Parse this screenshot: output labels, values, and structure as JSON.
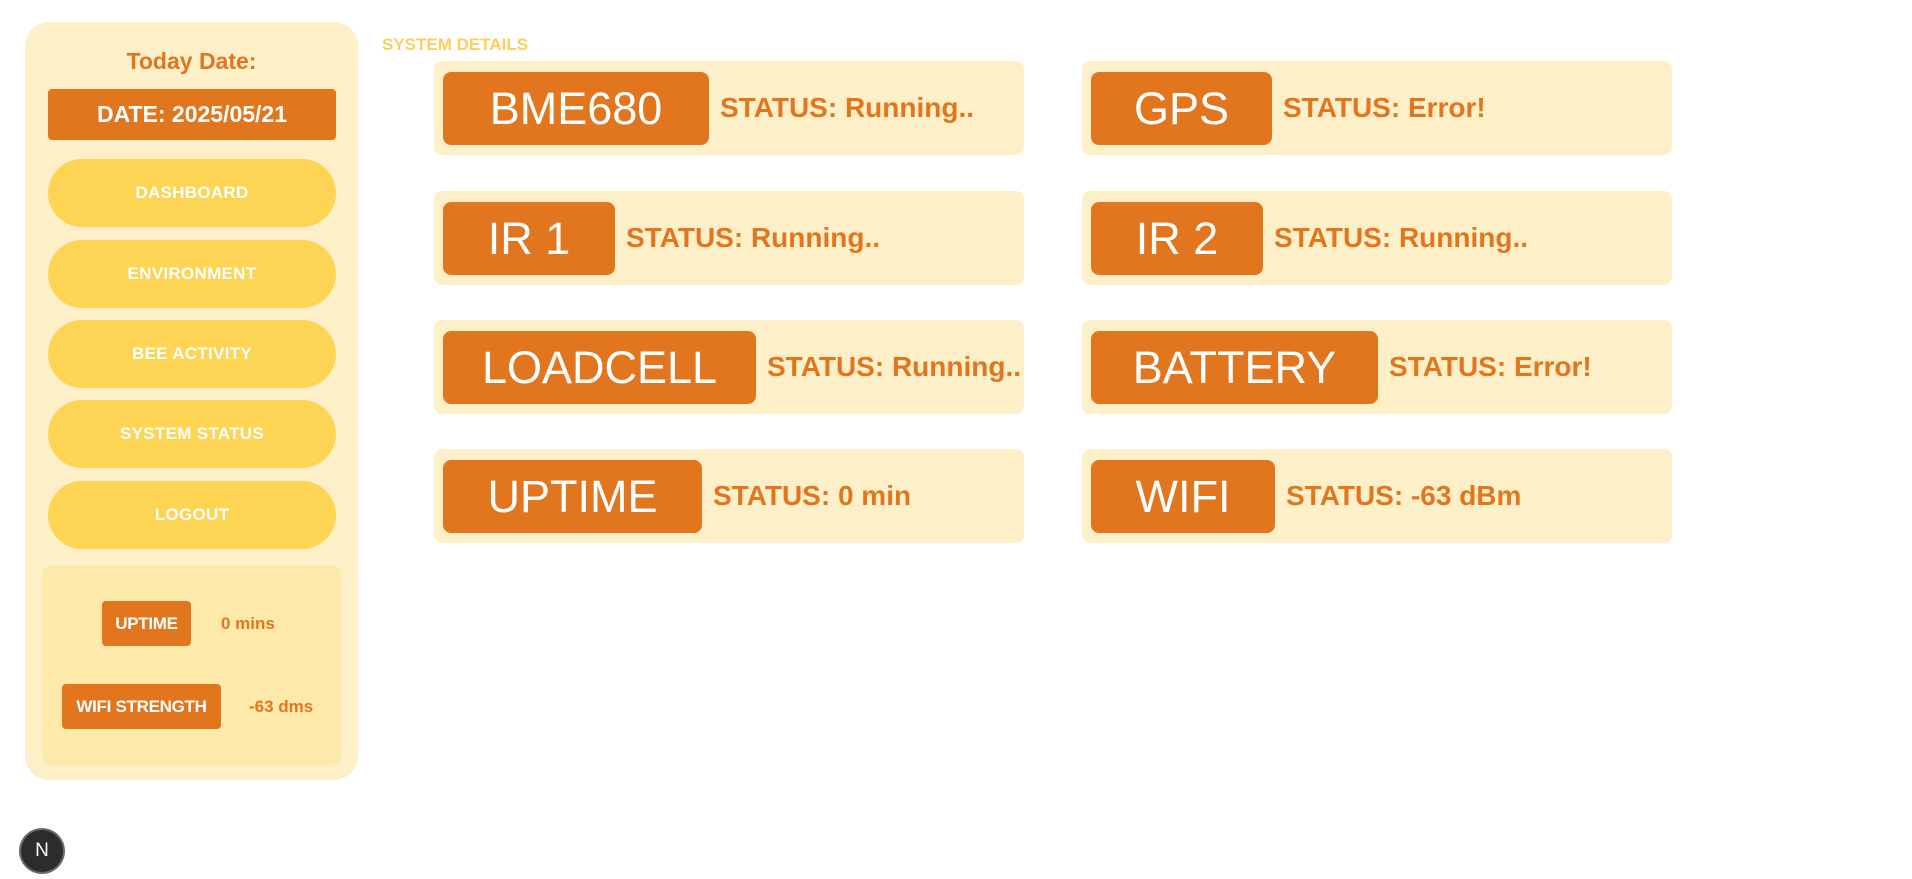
{
  "sidebar": {
    "date_title": "Today Date:",
    "date_value": "DATE: 2025/05/21",
    "nav": [
      {
        "label": "DASHBOARD"
      },
      {
        "label": "ENVIRONMENT"
      },
      {
        "label": "BEE ACTIVITY"
      },
      {
        "label": "SYSTEM STATUS"
      },
      {
        "label": "LOGOUT"
      }
    ],
    "summary": {
      "uptime_label": "UPTIME",
      "uptime_value": "0 mins",
      "wifi_label": "WIFI STRENGTH",
      "wifi_value": "-63 dms"
    }
  },
  "main": {
    "section_title": "SYSTEM DETAILS",
    "cards": [
      {
        "name": "BME680",
        "status": "STATUS: Running.."
      },
      {
        "name": "GPS",
        "status": "STATUS: Error!"
      },
      {
        "name": "IR 1",
        "status": "STATUS: Running.."
      },
      {
        "name": "IR 2",
        "status": "STATUS: Running.."
      },
      {
        "name": "LOADCELL",
        "status": "STATUS: Running.."
      },
      {
        "name": "BATTERY",
        "status": "STATUS: Error!"
      },
      {
        "name": "UPTIME",
        "status": "STATUS: 0 min"
      },
      {
        "name": "WIFI",
        "status": "STATUS: -63 dBm"
      }
    ]
  },
  "dev_indicator": {
    "label": "N",
    "icon": "nextjs-logo-icon"
  },
  "colors": {
    "accent": "#e2761e",
    "panel": "#fdf0c8",
    "nav_button": "#fdd454",
    "section_title": "#fdcf5a"
  }
}
